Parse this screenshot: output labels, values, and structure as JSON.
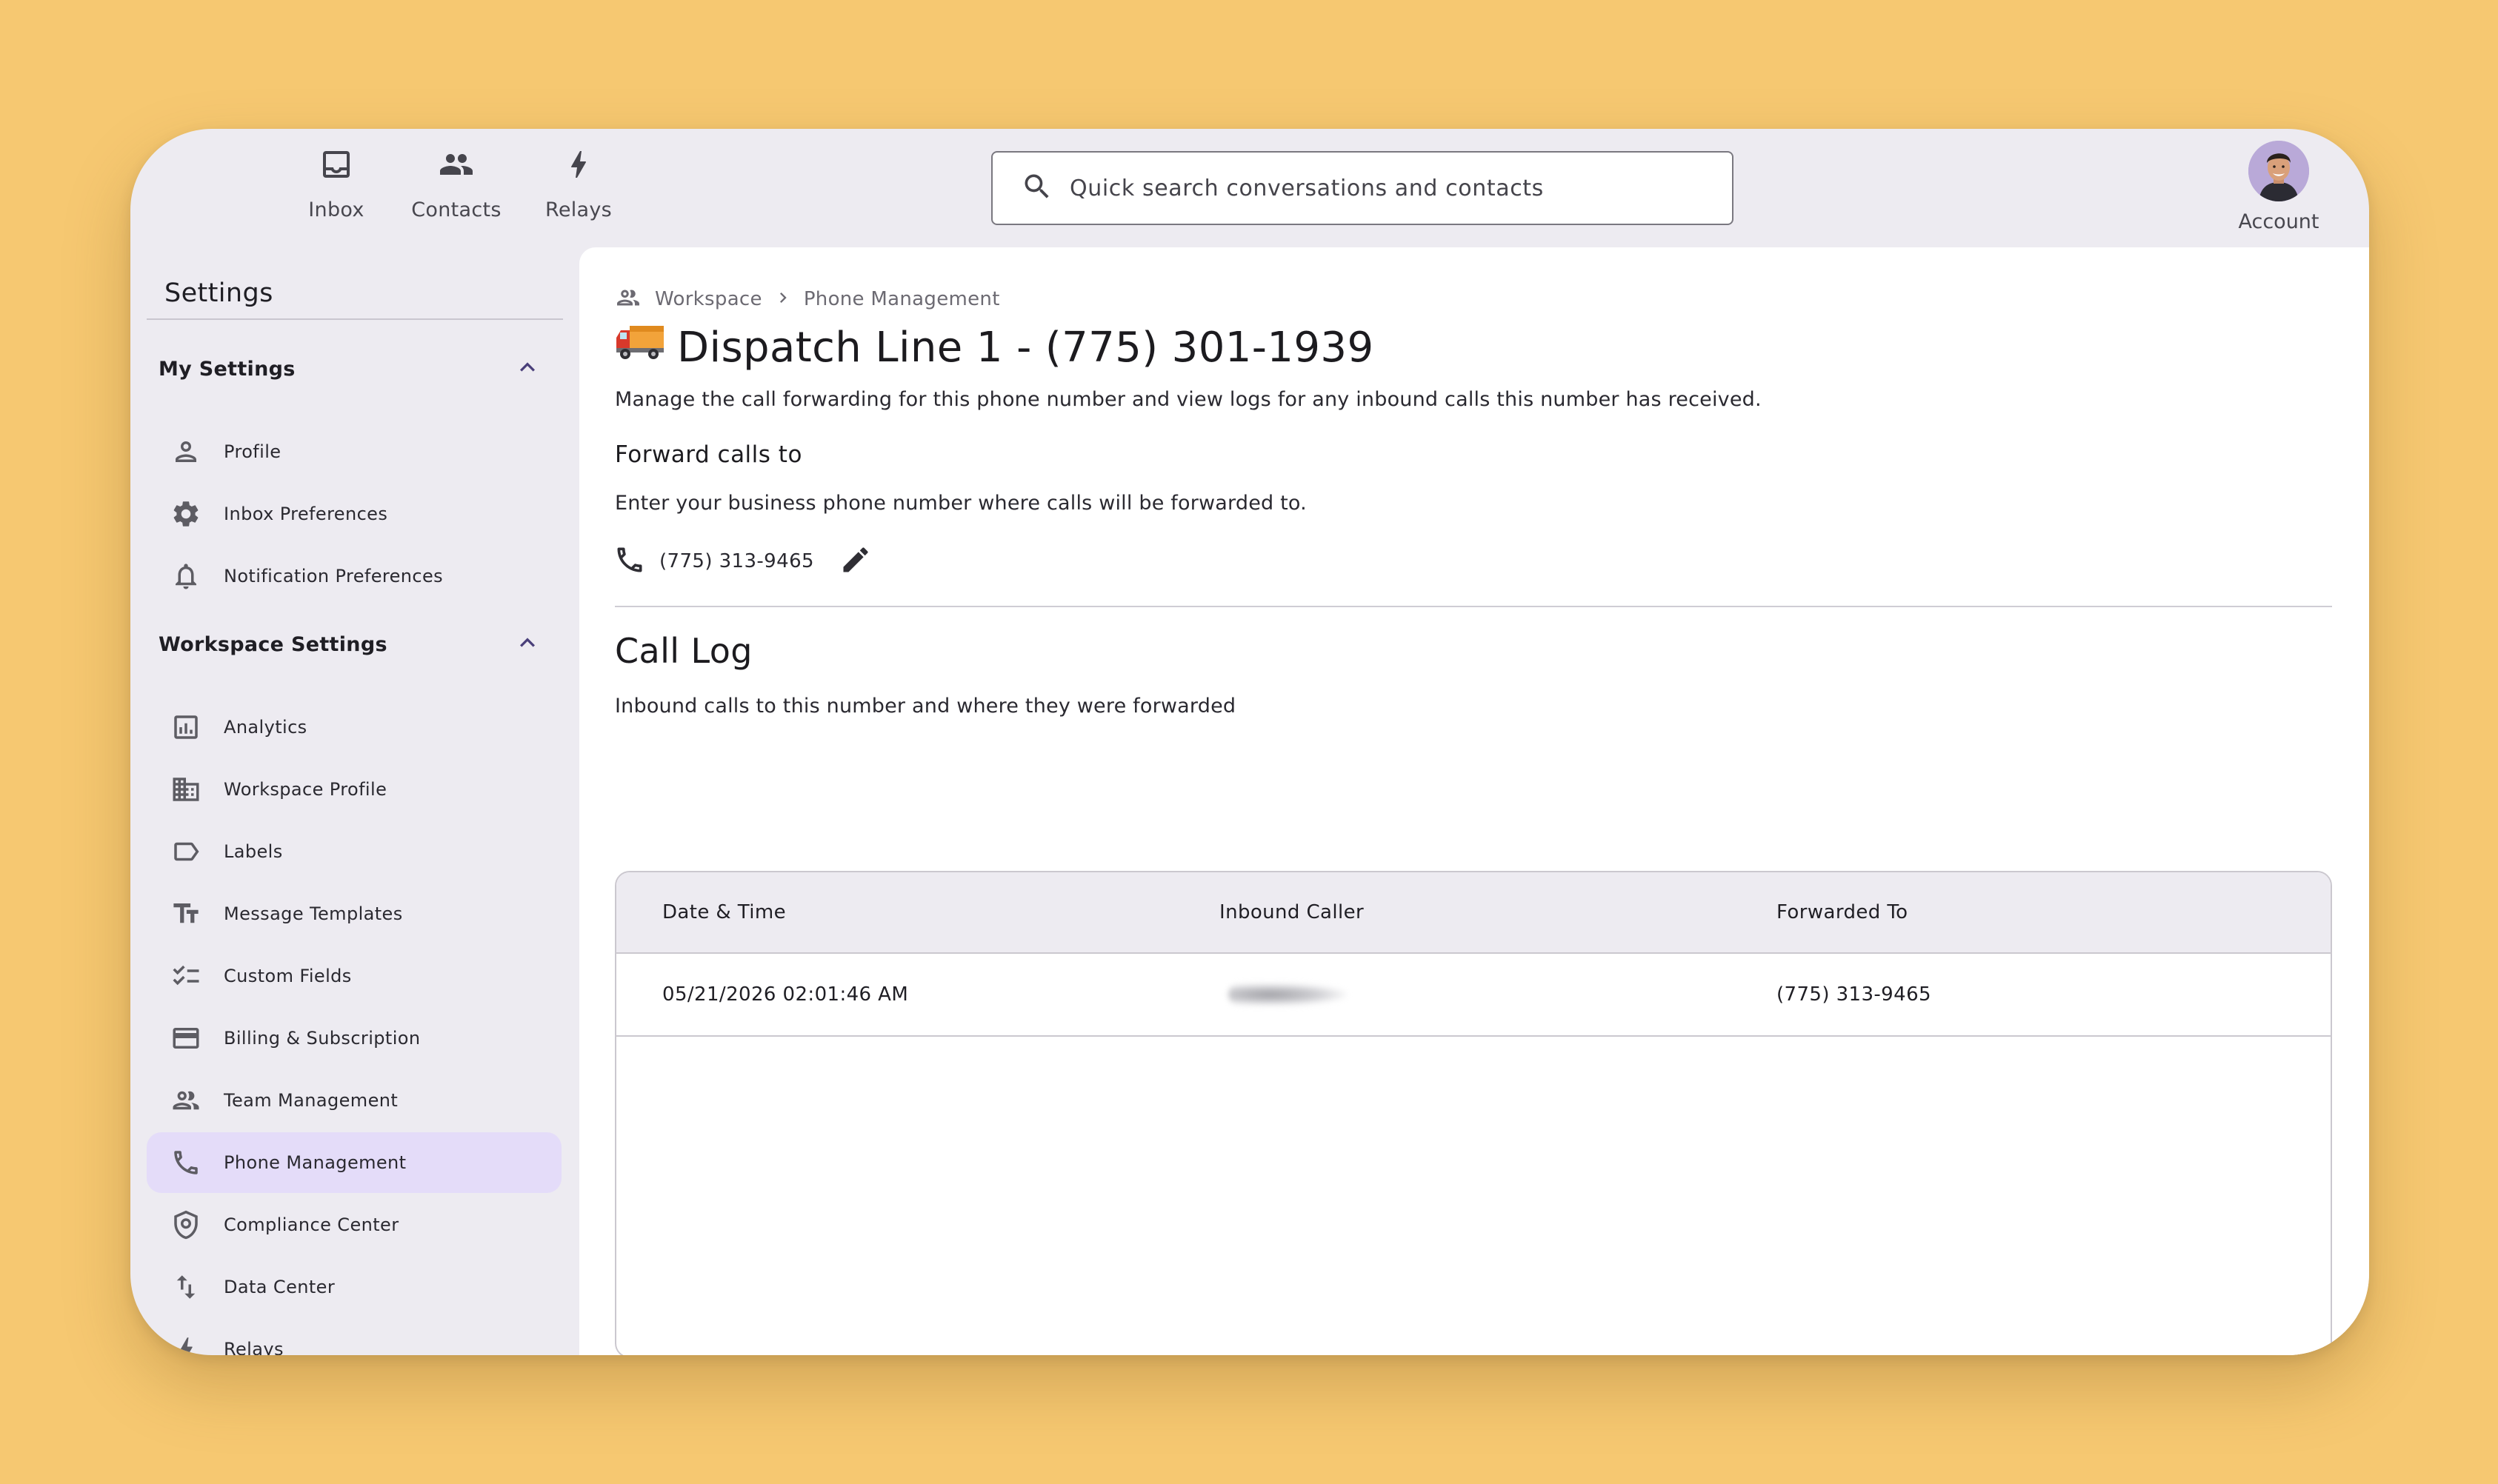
{
  "nav": {
    "inbox_label": "Inbox",
    "contacts_label": "Contacts",
    "relays_label": "Relays",
    "account_label": "Account"
  },
  "search": {
    "placeholder": "Quick search conversations and contacts"
  },
  "sidebar": {
    "title": "Settings",
    "my_settings": {
      "label": "My Settings",
      "items": [
        {
          "label": "Profile",
          "icon": "person-icon"
        },
        {
          "label": "Inbox Preferences",
          "icon": "gear-icon"
        },
        {
          "label": "Notification Preferences",
          "icon": "bell-icon"
        }
      ]
    },
    "workspace_settings": {
      "label": "Workspace Settings",
      "items": [
        {
          "label": "Analytics",
          "icon": "analytics-icon"
        },
        {
          "label": "Workspace Profile",
          "icon": "building-icon"
        },
        {
          "label": "Labels",
          "icon": "label-icon"
        },
        {
          "label": "Message Templates",
          "icon": "text-fields-icon"
        },
        {
          "label": "Custom Fields",
          "icon": "checklist-icon"
        },
        {
          "label": "Billing & Subscription",
          "icon": "credit-card-icon"
        },
        {
          "label": "Team Management",
          "icon": "group-icon"
        },
        {
          "label": "Phone Management",
          "icon": "phone-icon",
          "active": true
        },
        {
          "label": "Compliance Center",
          "icon": "shield-icon"
        },
        {
          "label": "Data Center",
          "icon": "swap-vert-icon"
        },
        {
          "label": "Relays",
          "icon": "bolt-icon"
        }
      ]
    }
  },
  "main": {
    "breadcrumb": {
      "root": "Workspace",
      "current": "Phone Management"
    },
    "title": "Dispatch Line 1 - (775) 301-1939",
    "description": "Manage the call forwarding for this phone number and view logs for any inbound calls this number has received.",
    "forward": {
      "heading": "Forward calls to",
      "subtitle": "Enter your business phone number where calls will be forwarded to.",
      "number": "(775) 313-9465"
    },
    "call_log": {
      "title": "Call Log",
      "subtitle": "Inbound calls to this number and where they were forwarded",
      "columns": [
        "Date & Time",
        "Inbound Caller",
        "Forwarded To"
      ],
      "rows": [
        {
          "date_time": "05/21/2026 02:01:46 AM",
          "caller": "",
          "forwarded_to": "(775) 313-9465"
        }
      ]
    }
  },
  "colors": {
    "background": "#F6C871",
    "window": "#EDEBF1",
    "active_item": "#E4DCF9",
    "accent": "#4a3f7a"
  }
}
